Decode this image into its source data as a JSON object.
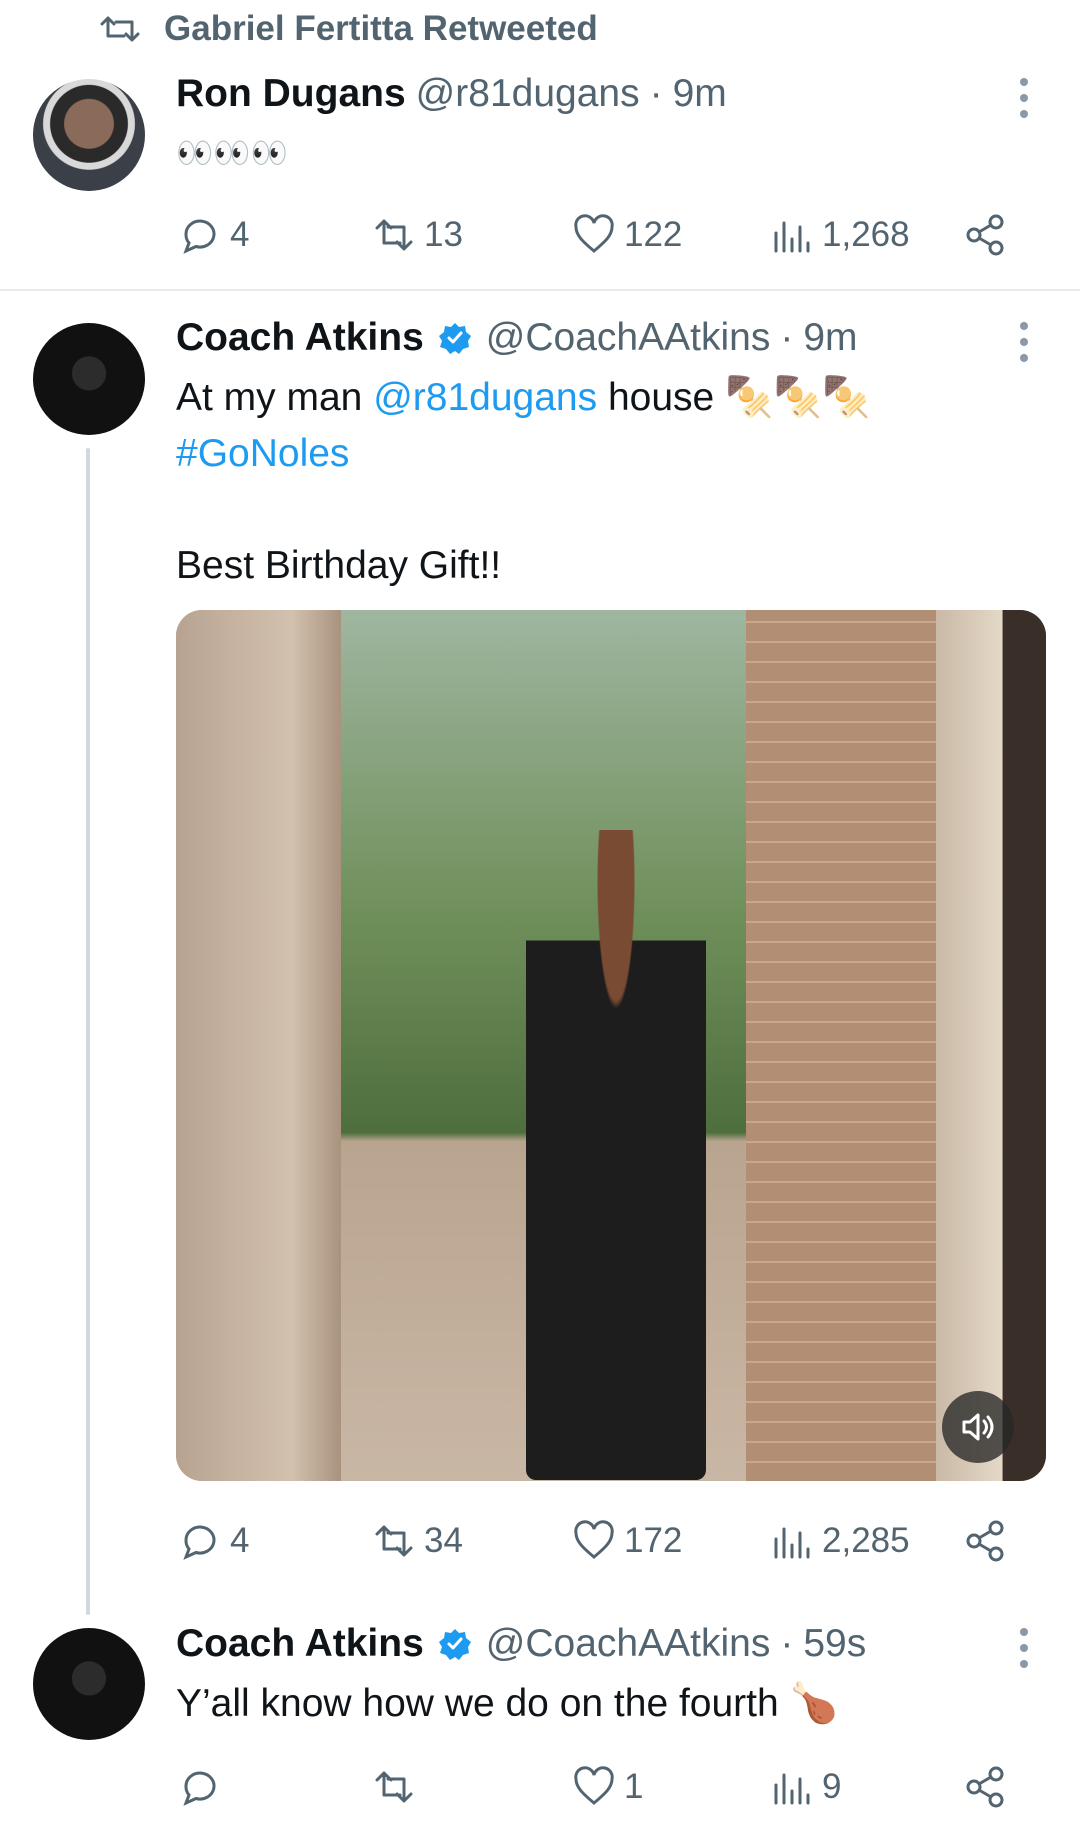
{
  "retweet": {
    "label": "Gabriel Fertitta Retweeted"
  },
  "tweet1": {
    "name": "Ron Dugans",
    "handle": "@r81dugans",
    "sep": "·",
    "time": "9m",
    "text": "👀👀👀",
    "replies": "4",
    "reposts": "13",
    "likes": "122",
    "views": "1,268"
  },
  "tweet2": {
    "name": "Coach Atkins",
    "handle": "@CoachAAtkins",
    "sep": "·",
    "time": "9m",
    "text_a": "At my man ",
    "mention": "@r81dugans",
    "text_b": " house 🍢🍢🍢",
    "hashtag": "#GoNoles",
    "text_c": "Best Birthday Gift!!",
    "replies": "4",
    "reposts": "34",
    "likes": "172",
    "views": "2,285"
  },
  "tweet3": {
    "name": "Coach Atkins",
    "handle": "@CoachAAtkins",
    "sep": "·",
    "time": "59s",
    "text": "Y’all know how we do on the fourth 🍗",
    "replies": "",
    "reposts": "",
    "likes": "1",
    "views": "9"
  },
  "colors": {
    "accent": "#1d9bf0",
    "text": "#0f1419",
    "muted": "#536471"
  },
  "icons": [
    "retweet-icon",
    "reply-icon",
    "like-icon",
    "views-icon",
    "share-icon",
    "more-icon",
    "verified-icon",
    "volume-icon"
  ]
}
